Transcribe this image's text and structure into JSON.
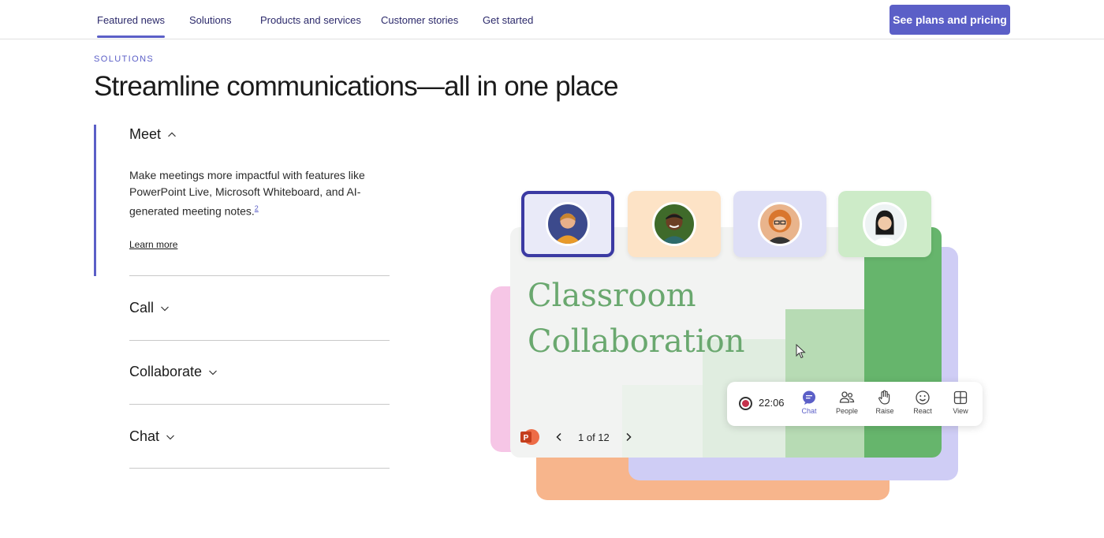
{
  "nav": {
    "tabs": [
      {
        "label": "Featured news",
        "active": true
      },
      {
        "label": "Solutions",
        "active": false
      },
      {
        "label": "Products and services",
        "active": false
      },
      {
        "label": "Customer stories",
        "active": false
      },
      {
        "label": "Get started",
        "active": false
      }
    ],
    "cta_label": "See plans and pricing"
  },
  "section": {
    "eyebrow": "SOLUTIONS",
    "title": "Streamline communications—all in one place"
  },
  "accordion": {
    "items": [
      {
        "label": "Meet",
        "expanded": true
      },
      {
        "label": "Call",
        "expanded": false
      },
      {
        "label": "Collaborate",
        "expanded": false
      },
      {
        "label": "Chat",
        "expanded": false
      }
    ],
    "meet_description": "Make meetings more impactful with features like PowerPoint Live, Microsoft Whiteboard, and AI-generated meeting notes.",
    "meet_footnote": "2",
    "learn_more": "Learn more"
  },
  "illustration": {
    "slide_title_line1": "Classroom",
    "slide_title_line2": "Collaboration",
    "pager": "1 of 12",
    "timer": "22:06",
    "controls": [
      "Chat",
      "People",
      "Raise",
      "React",
      "View"
    ],
    "powerpoint_letter": "P"
  },
  "colors": {
    "accent": "#5b5fc7",
    "slide_green": "#6aa86f",
    "record_red": "#c4314b"
  }
}
